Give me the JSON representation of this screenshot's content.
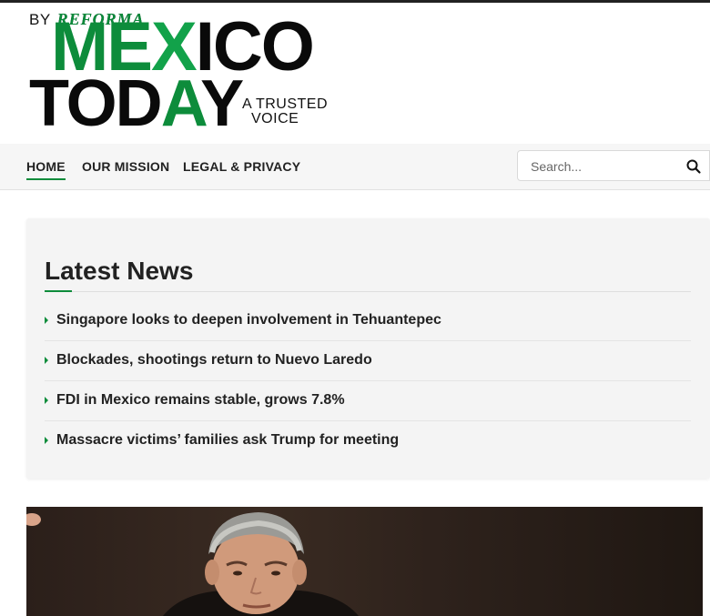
{
  "logo": {
    "by": "BY",
    "brand": "REFORMA",
    "line1": [
      "ME",
      "X",
      "ICO"
    ],
    "line2": [
      "TOD",
      "A",
      "Y"
    ],
    "tagline": [
      "A TRUSTED",
      "VOICE"
    ]
  },
  "nav": {
    "items": [
      {
        "label": "HOME",
        "active": true
      },
      {
        "label": "OUR MISSION",
        "active": false
      },
      {
        "label": "LEGAL & PRIVACY",
        "active": false
      }
    ],
    "search_placeholder": "Search...",
    "search_icon": "search-icon"
  },
  "latest_news": {
    "title": "Latest News",
    "items": [
      "Singapore looks to deepen involvement in Tehuantepec",
      "Blockades, shootings return to Nuevo Laredo",
      "FDI in Mexico remains stable, grows 7.8%",
      "Massacre victims’ families ask Trump for meeting"
    ]
  },
  "colors": {
    "accent_green": "#0d8c3b",
    "text_dark": "#222222",
    "nav_bg": "#f6f6f6",
    "card_bg": "#f4f4f4"
  }
}
